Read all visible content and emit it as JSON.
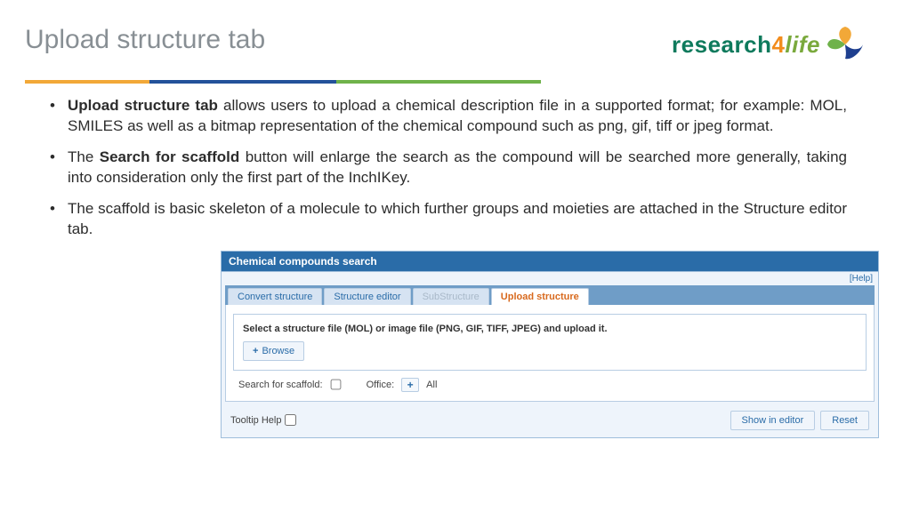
{
  "header": {
    "title": "Upload structure tab",
    "logo": {
      "part1": "research",
      "part2": "4",
      "part3": "life"
    }
  },
  "bullets": [
    {
      "bold": "Upload structure tab",
      "rest": " allows users to upload a chemical description file in a supported format; for example: MOL, SMILES as well as a bitmap representation of the chemical compound such as png, gif, tiff or jpeg format."
    },
    {
      "bold": "Search for scaffold",
      "prefix": "The ",
      "rest": " button will enlarge the search as the compound will be searched more generally, taking into consideration only the first part of the InchIKey."
    },
    {
      "plain": "The scaffold is basic skeleton of a molecule to which further groups and moieties are attached in the Structure editor tab."
    }
  ],
  "panel": {
    "title": "Chemical compounds search",
    "help_label": "[Help]",
    "tabs": [
      {
        "label": "Convert structure",
        "state": "normal"
      },
      {
        "label": "Structure editor",
        "state": "normal"
      },
      {
        "label": "SubStructure",
        "state": "disabled"
      },
      {
        "label": "Upload structure",
        "state": "active"
      }
    ],
    "upload": {
      "instruction": "Select a structure file (MOL) or image file (PNG, GIF, TIFF, JPEG) and upload it.",
      "browse_label": "Browse"
    },
    "options": {
      "scaffold_label": "Search for scaffold:",
      "office_label": "Office:",
      "all_label": "All"
    },
    "footer": {
      "tooltip_label": "Tooltip Help",
      "show_label": "Show in editor",
      "reset_label": "Reset"
    }
  }
}
